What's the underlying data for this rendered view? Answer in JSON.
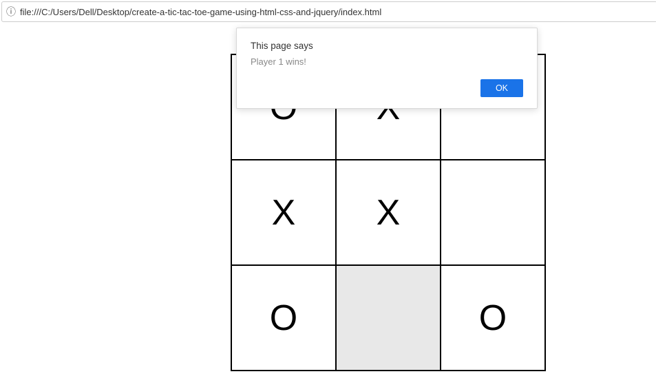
{
  "address_bar": {
    "url": "file:///C:/Users/Dell/Desktop/create-a-tic-tac-toe-game-using-html-css-and-jquery/index.html"
  },
  "alert": {
    "title": "This page says",
    "message": "Player 1 wins!",
    "ok_label": "OK"
  },
  "board": {
    "cells": [
      {
        "value": "O",
        "highlight": false
      },
      {
        "value": "X",
        "highlight": false
      },
      {
        "value": "",
        "highlight": false
      },
      {
        "value": "X",
        "highlight": false
      },
      {
        "value": "X",
        "highlight": false
      },
      {
        "value": "",
        "highlight": false
      },
      {
        "value": "O",
        "highlight": false
      },
      {
        "value": "",
        "highlight": true
      },
      {
        "value": "O",
        "highlight": false
      }
    ]
  }
}
